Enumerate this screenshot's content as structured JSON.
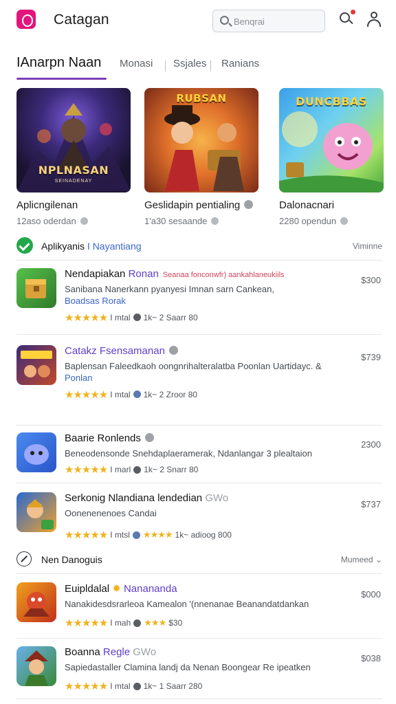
{
  "colors": {
    "brand": "#e2157c",
    "accent": "#7c3fb5",
    "star": "#f1b21b",
    "verified": "#22a84a"
  },
  "header": {
    "app_title": "Catagan",
    "search_placeholder": "Benqrai",
    "icons": [
      "logo-icon",
      "search-icon",
      "notification-icon",
      "user-icon"
    ]
  },
  "tabs": [
    {
      "label": "IAnarpn Naan"
    },
    {
      "label": "Monasi"
    },
    {
      "label": "Ssjales"
    },
    {
      "label": "Ranians"
    }
  ],
  "featured": [
    {
      "name": "Aplicngilenan",
      "meta": "12aso oderdan",
      "art_title": "NPLNASAN",
      "art_sub": "SEINADENAY"
    },
    {
      "name": "Geslidapin pentialing",
      "meta": "1'a30 sesaande",
      "art_title": "RUBSAN",
      "art_sub": ""
    },
    {
      "name": "Dalonacnari",
      "meta": "2280 opendun",
      "art_title": "DUNCBBAS",
      "art_sub": ""
    }
  ],
  "section_primary": {
    "title": "Aplikyanis",
    "title_accent": "I Nayantiang",
    "right": "Viminne"
  },
  "list": [
    {
      "title": "Nendapiakan",
      "brand": "Ronan",
      "tagline": "Seanaa fonconwfr) aankahlaneukiils",
      "desc_line1": "Sanibana Nanerkann pyanyesi Imnan sarn Cankean,",
      "desc_link": "Boadsas Rorak",
      "rating_text": "I mtal",
      "meta": "1k~ 2 Saarr 80",
      "price": "$300"
    },
    {
      "title": "Catakz Fsensamanan",
      "brand": "",
      "tagline": "",
      "desc_line1": "Baplensan Faleedkaoh oongnrihalteralatba Poonlan Uartidayc. &",
      "desc_link": "Ponlan",
      "rating_text": "I mtal",
      "meta": "1k~ 2 Zroor 80",
      "price": "$739"
    },
    {
      "title": "Baarie Ronlends",
      "brand": "",
      "tagline": "",
      "desc_line1": "Beneodensonde Snehdaplaeramerak, Ndanlangar 3 plealtaion",
      "desc_link": "",
      "rating_text": "I marl",
      "meta": "1k~ 2 Snarr 80",
      "price": "2300"
    },
    {
      "title": "Serkonig Nlandiana lendedian",
      "brand": "",
      "tagline": "",
      "muted": "GWo",
      "desc_line1": "Oonenenenoes Candai",
      "desc_link": "",
      "rating_text": "I mtsl",
      "meta": "1k~ adioog 800",
      "price": "$737"
    }
  ],
  "section_secondary": {
    "title": "Nen Danoguis",
    "right": "Mumeed"
  },
  "list2": [
    {
      "title": "Euipldalal",
      "brand": "Nanananda",
      "tagline": "",
      "desc_line1": "Nanakidesdsrarleoa Kamealon '(nnenanae Beanandatdankan",
      "desc_link": "",
      "rating_text": "I mah",
      "meta": "$30",
      "price": "$000"
    },
    {
      "title": "Boanna",
      "brand": "Regle",
      "tagline": "",
      "muted": "GWo",
      "desc_line1": "Sapiedastaller Clamina landj da Nenan Boongear Re ipeatken",
      "desc_link": "",
      "rating_text": "I mtal",
      "meta": "1k~ 1 Saarr 280",
      "price": "$038"
    }
  ]
}
